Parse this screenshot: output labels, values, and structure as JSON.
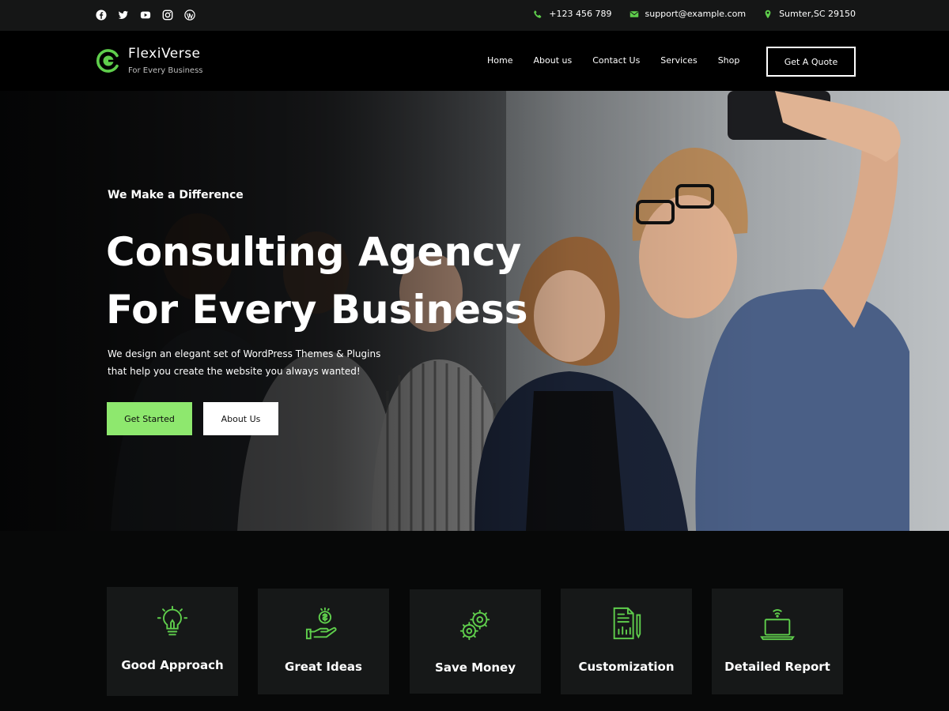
{
  "topbar": {
    "social": [
      "facebook-icon",
      "twitter-icon",
      "youtube-icon",
      "instagram-icon",
      "wordpress-icon"
    ],
    "phone": "+123 456 789",
    "email": "support@example.com",
    "location": "Sumter,SC 29150"
  },
  "header": {
    "brand": "FlexiVerse",
    "tagline": "For Every Business",
    "nav": [
      "Home",
      "About us",
      "Contact Us",
      "Services",
      "Shop"
    ],
    "cta": "Get A Quote"
  },
  "hero": {
    "kicker": "We Make a Difference",
    "headline_line1": "Consulting Agency",
    "headline_line2": "For Every Business",
    "desc_line1": "We design an elegant set of WordPress Themes & Plugins",
    "desc_line2": "that help you create the website you always wanted!",
    "primary_button": "Get Started",
    "secondary_button": "About Us"
  },
  "features": [
    {
      "label": "Good Approach",
      "icon": "lightbulb-icon"
    },
    {
      "label": "Great Ideas",
      "icon": "hand-coin-icon"
    },
    {
      "label": "Save Money",
      "icon": "gears-icon"
    },
    {
      "label": "Customization",
      "icon": "document-chart-icon"
    },
    {
      "label": "Detailed Report",
      "icon": "laptop-wifi-icon"
    }
  ],
  "colors": {
    "accent": "#5fce4c",
    "button_green": "#8ee86e",
    "topbar_bg": "#151616",
    "header_bg": "#000000",
    "card_bg": "#161818"
  }
}
